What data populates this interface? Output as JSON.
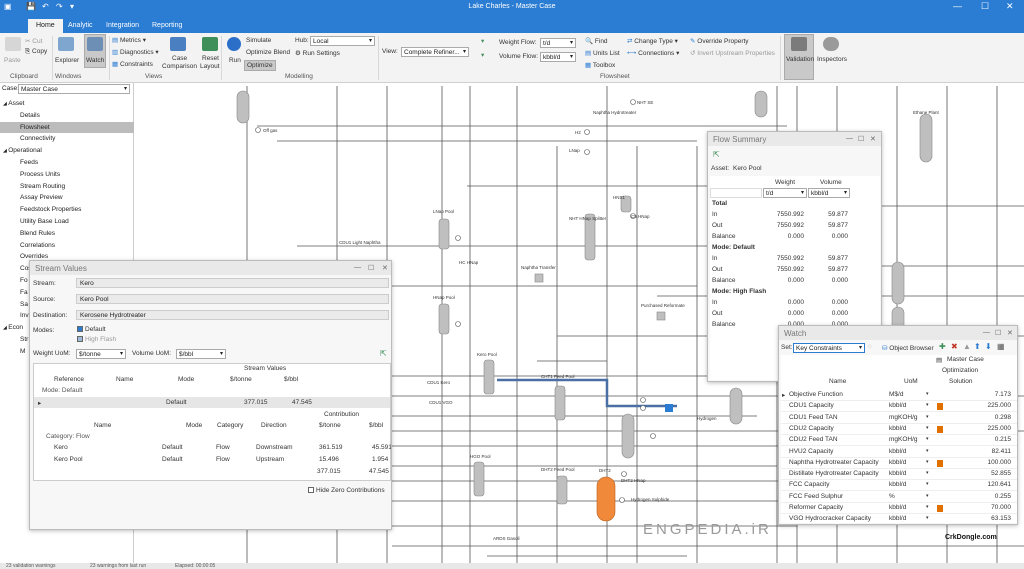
{
  "window": {
    "title": "Lake Charles - Master Case"
  },
  "tabs": [
    "Home",
    "Analytic",
    "Integration",
    "Reporting"
  ],
  "ribbon": {
    "paste": "Paste",
    "cut": "Cut",
    "copy": "Copy",
    "explorer": "Explorer",
    "watch": "Watch",
    "metrics": "Metrics",
    "diagnostics": "Diagnostics",
    "constraints": "Constraints",
    "case_comparison_1": "Case",
    "case_comparison_2": "Comparison",
    "reset_layout_1": "Reset",
    "reset_layout_2": "Layout",
    "run": "Run",
    "simulate": "Simulate",
    "optimize_blend": "Optimize Blend",
    "optimize": "Optimize",
    "hub_label": "Hub:",
    "hub_value": "Local",
    "run_settings": "Run Settings",
    "view_label": "View:",
    "view_value": "Complete Refiner...",
    "weight_flow_label": "Weight Flow:",
    "weight_flow_value": "t/d",
    "volume_flow_label": "Volume Flow:",
    "volume_flow_value": "kbbl/d",
    "find": "Find",
    "units_list": "Units List",
    "toolbox": "Toolbox",
    "change_type": "Change Type",
    "connections": "Connections",
    "override_property": "Override Property",
    "invert_upstream": "Invert Upstream Properties",
    "validation": "Validation",
    "inspectors": "Inspectors",
    "groups": {
      "clipboard": "Clipboard",
      "windows": "Windows",
      "views": "Views",
      "modelling": "Modelling",
      "flowsheet": "Flowsheet"
    }
  },
  "left": {
    "case_label": "Case:",
    "case_value": "Master Case",
    "tree": [
      {
        "text": "Asset",
        "level": 0,
        "toggle": "◢"
      },
      {
        "text": "Details",
        "level": 2
      },
      {
        "text": "Flowsheet",
        "level": 2,
        "selected": true
      },
      {
        "text": "Connectivity",
        "level": 2
      },
      {
        "text": "Operational",
        "level": 0,
        "toggle": "◢"
      },
      {
        "text": "Feeds",
        "level": 2
      },
      {
        "text": "Process Units",
        "level": 2
      },
      {
        "text": "Stream Routing",
        "level": 2
      },
      {
        "text": "Assay Preview",
        "level": 2
      },
      {
        "text": "Feedstock Properties",
        "level": 2
      },
      {
        "text": "Utility Base Load",
        "level": 2
      },
      {
        "text": "Blend Rules",
        "level": 2
      },
      {
        "text": "Correlations",
        "level": 2
      },
      {
        "text": "Overrides",
        "level": 2
      },
      {
        "text": "Cost",
        "level": 2
      },
      {
        "text": "Fo",
        "level": 2
      },
      {
        "text": "Fa",
        "level": 2
      },
      {
        "text": "Sa",
        "level": 2
      },
      {
        "text": "Inv",
        "level": 2
      },
      {
        "text": "Econ",
        "level": 0,
        "toggle": "◢"
      },
      {
        "text": "Str",
        "level": 2
      },
      {
        "text": "M",
        "level": 2
      }
    ]
  },
  "stream_values": {
    "title": "Stream Values",
    "stream_label": "Stream:",
    "stream": "Kero",
    "source_label": "Source:",
    "source": "Kero Pool",
    "dest_label": "Destination:",
    "dest": "Kerosene Hydrotreater",
    "modes_label": "Modes:",
    "mode1": "Default",
    "mode2": "High Flash",
    "weight_uom_label": "Weight UoM:",
    "weight_uom": "$/tonne",
    "volume_uom_label": "Volume UoM:",
    "volume_uom": "$/bbl",
    "section": "Stream Values",
    "cols": [
      "Reference",
      "Name",
      "Mode",
      "$/tonne",
      "$/bbl"
    ],
    "group": "Mode: Default",
    "row": {
      "mode": "Default",
      "tonne": "377.015",
      "bbl": "47.545"
    },
    "contribution_label": "Contribution",
    "ccols": [
      "Name",
      "Mode",
      "Category",
      "Direction",
      "$/tonne",
      "$/bbl"
    ],
    "cgroup": "Category: Flow",
    "crows": [
      {
        "name": "Kero",
        "mode": "Default",
        "cat": "Flow",
        "dir": "Downstream",
        "t": "361.519",
        "b": "45.591"
      },
      {
        "name": "Kero Pool",
        "mode": "Default",
        "cat": "Flow",
        "dir": "Upstream",
        "t": "15.496",
        "b": "1.954"
      }
    ],
    "total": {
      "t": "377.015",
      "b": "47.545"
    },
    "hide_zero": "Hide Zero Contributions"
  },
  "flow_summary": {
    "title": "Flow Summary",
    "asset_label": "Asset:",
    "asset": "Kero Pool",
    "h_weight": "Weight",
    "h_volume": "Volume",
    "u_weight": "t/d",
    "u_volume": "kbbl/d",
    "sections": [
      {
        "name": "Total",
        "rows": [
          {
            "k": "In",
            "w": "7550.992",
            "v": "59.877"
          },
          {
            "k": "Out",
            "w": "7550.992",
            "v": "59.877"
          },
          {
            "k": "Balance",
            "w": "0.000",
            "v": "0.000"
          }
        ]
      },
      {
        "name": "Mode: Default",
        "rows": [
          {
            "k": "In",
            "w": "7550.992",
            "v": "59.877"
          },
          {
            "k": "Out",
            "w": "7550.992",
            "v": "59.877"
          },
          {
            "k": "Balance",
            "w": "0.000",
            "v": "0.000"
          }
        ]
      },
      {
        "name": "Mode: High Flash",
        "rows": [
          {
            "k": "In",
            "w": "0.000",
            "v": "0.000"
          },
          {
            "k": "Out",
            "w": "0.000",
            "v": "0.000"
          },
          {
            "k": "Balance",
            "w": "0.000",
            "v": "0.000"
          }
        ]
      }
    ]
  },
  "watch": {
    "title": "Watch",
    "set_label": "Set:",
    "set_value": "Key Constraints",
    "object_browser": "Object Browser",
    "col_case": "Master Case",
    "col_opt": "Optimization",
    "col_sol": "Solution",
    "col_name": "Name",
    "col_uom": "UoM",
    "rows": [
      {
        "name": "Objective Function",
        "uom": "M$/d",
        "val": "7.173",
        "flag": false
      },
      {
        "name": "CDU1 Capacity",
        "uom": "kbbl/d",
        "val": "225.000",
        "flag": true
      },
      {
        "name": "CDU1 Feed TAN",
        "uom": "mgKOH/g",
        "val": "0.298",
        "flag": false
      },
      {
        "name": "CDU2 Capacity",
        "uom": "kbbl/d",
        "val": "225.000",
        "flag": true
      },
      {
        "name": "CDU2 Feed TAN",
        "uom": "mgKOH/g",
        "val": "0.215",
        "flag": false
      },
      {
        "name": "HVU2 Capacity",
        "uom": "kbbl/d",
        "val": "82.411",
        "flag": false
      },
      {
        "name": "Naphtha Hydrotreater Capacity",
        "uom": "kbbl/d",
        "val": "100.000",
        "flag": true
      },
      {
        "name": "Distillate Hydrotreater Capacity",
        "uom": "kbbl/d",
        "val": "52.855",
        "flag": false
      },
      {
        "name": "FCC Capacity",
        "uom": "kbbl/d",
        "val": "120.641",
        "flag": false
      },
      {
        "name": "FCC Feed Sulphur",
        "uom": "%",
        "val": "0.255",
        "flag": false
      },
      {
        "name": "Reformer Capacity",
        "uom": "kbbl/d",
        "val": "70.000",
        "flag": true
      },
      {
        "name": "VGO Hydrocracker Capacity",
        "uom": "kbbl/d",
        "val": "63.153",
        "flag": false
      }
    ]
  },
  "flowsheet_labels": [
    {
      "t": "Off gas"
    },
    {
      "t": "Naphtha Hydrotreater"
    },
    {
      "t": "NHT SE"
    },
    {
      "t": "H2"
    },
    {
      "t": "LNap"
    },
    {
      "t": "Ethane Plant"
    },
    {
      "t": "HNS1"
    },
    {
      "t": "C5 HNap"
    },
    {
      "t": "NHT HNap Splitter"
    },
    {
      "t": "LNap Pool"
    },
    {
      "t": "CDU1 Light Naphtha"
    },
    {
      "t": "HC HNap"
    },
    {
      "t": "Naphtha Transfer"
    },
    {
      "t": "HNap Pool"
    },
    {
      "t": "Purchased Reformate"
    },
    {
      "t": "Kero Pool"
    },
    {
      "t": "CDU1 Kero"
    },
    {
      "t": "CHT1 Feed Pool"
    },
    {
      "t": "Hydrogen"
    },
    {
      "t": "CDU1 VGO"
    },
    {
      "t": "HGO Pool"
    },
    {
      "t": "DHT2 Feed Pool"
    },
    {
      "t": "DHT2 HNap"
    },
    {
      "t": "DHT2"
    },
    {
      "t": "Hydrogen Sulphide"
    },
    {
      "t": "ARDS Gasoil"
    }
  ],
  "status": {
    "s1": "23 validation warnings",
    "s2": "23 warnings from last run",
    "s3": "Elapsed: 00:00:05"
  },
  "watermark": "ENGPEDIA.iR",
  "crk": "CrkDongle.com",
  "colors": {
    "accent": "#2b7cd3",
    "constraint_flag": "#e07000",
    "vessel": "#bfbfbf",
    "active_unit": "#f08a3a"
  }
}
